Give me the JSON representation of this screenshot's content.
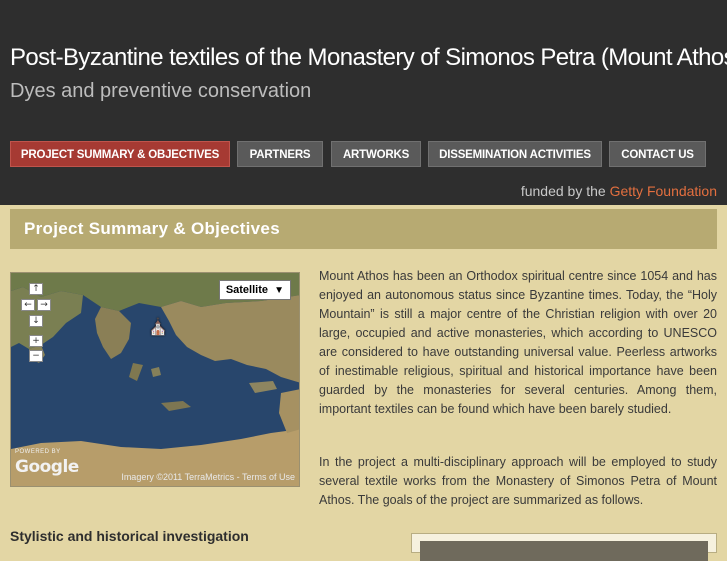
{
  "header": {
    "title": "Post-Byzantine textiles of the Monastery of Simonos Petra (Mount Athos)",
    "subtitle": "Dyes and preventive conservation",
    "funded_prefix": "funded by the",
    "funded_org": "Getty Foundation"
  },
  "nav": {
    "items": [
      {
        "label": "PROJECT SUMMARY & OBJECTIVES",
        "active": true
      },
      {
        "label": "PARTNERS",
        "active": false
      },
      {
        "label": "ARTWORKS",
        "active": false
      },
      {
        "label": "DISSEMINATION ACTIVITIES",
        "active": false
      },
      {
        "label": "CONTACT US",
        "active": false
      }
    ]
  },
  "section": {
    "title": "Project Summary & Objectives"
  },
  "map": {
    "type_label": "Satellite",
    "powered_by": "POWERED BY",
    "logo": "Google",
    "credits": "Imagery ©2011 TerraMetrics - Terms of Use",
    "controls": {
      "pan_up": "↑",
      "pan_left": "←",
      "pan_right": "→",
      "pan_down": "↓",
      "zoom_in": "+",
      "zoom_out": "−"
    },
    "marker_icon": "church-icon"
  },
  "content": {
    "paragraph1": "Mount Athos has been an Orthodox spiritual centre since 1054 and has enjoyed an autonomous status since Byzantine times. Today, the “Holy Mountain” is still a major centre of the Christian religion with over 20 large, occupied and active monasteries, which according to UNESCO are considered to have outstanding universal value. Peerless artworks of inestimable religious, spiritual and historical importance have been guarded by the monasteries for several centuries. Among them, important textiles can be found which have been barely studied.",
    "paragraph2": "In the project a multi-disciplinary approach will be employed to study several textile works from the Monastery of Simonos Petra of Mount Athos. The goals of the project are summarized as follows.",
    "subheading": "Stylistic and historical investigation"
  },
  "colors": {
    "header_bg": "#2e2e2e",
    "page_bg": "#e3d6a4",
    "nav_active": "#a63a33",
    "nav_default": "#5a5a5a",
    "section_bar": "#b7aa72",
    "getty_accent": "#e36f3f"
  }
}
